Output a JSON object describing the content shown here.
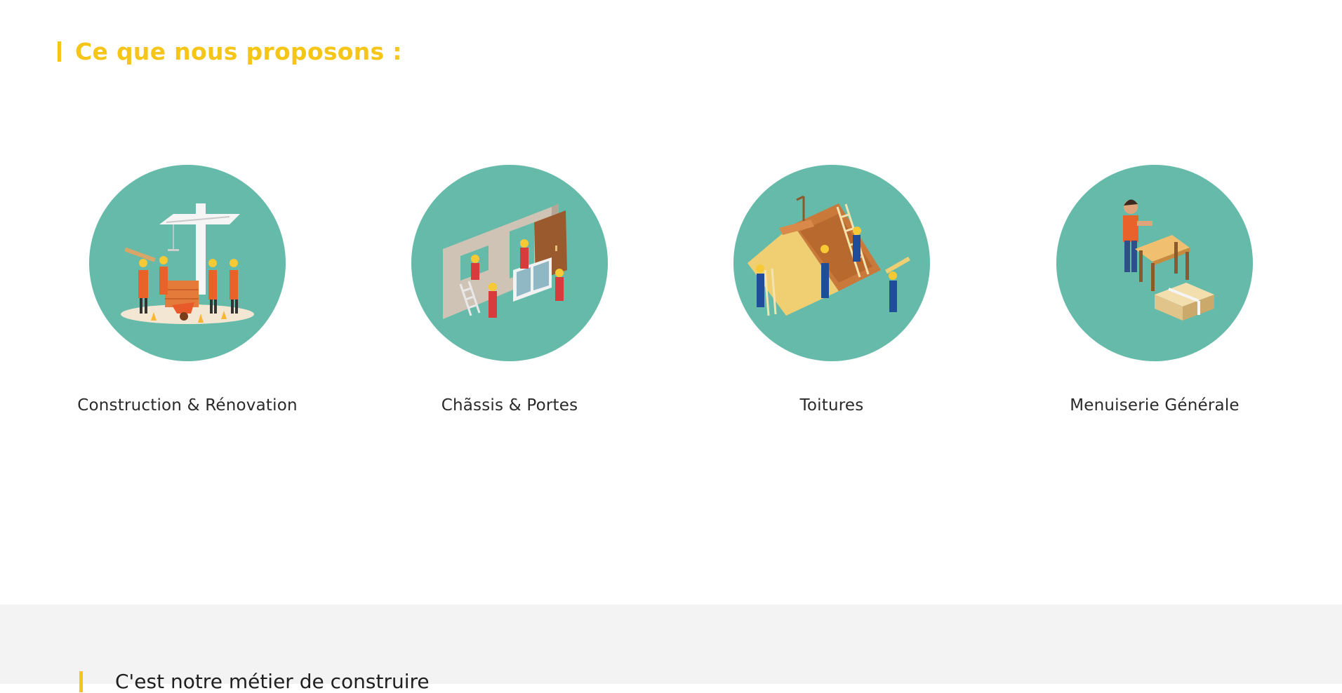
{
  "section": {
    "heading": "Ce que nous proposons :"
  },
  "services": [
    {
      "label": "Construction & Rénovation",
      "icon": "construction-illustration-icon"
    },
    {
      "label": "Chãssis & Portes",
      "icon": "window-door-illustration-icon"
    },
    {
      "label": "Toitures",
      "icon": "roofing-illustration-icon"
    },
    {
      "label": "Menuiserie Générale",
      "icon": "carpentry-illustration-icon"
    }
  ],
  "next_section": {
    "heading": "C'est notre métier de construire"
  },
  "colors": {
    "accent": "#f5c518",
    "circle": "#65baa9",
    "text": "#2a2a2a",
    "band": "#f3f3f3"
  }
}
